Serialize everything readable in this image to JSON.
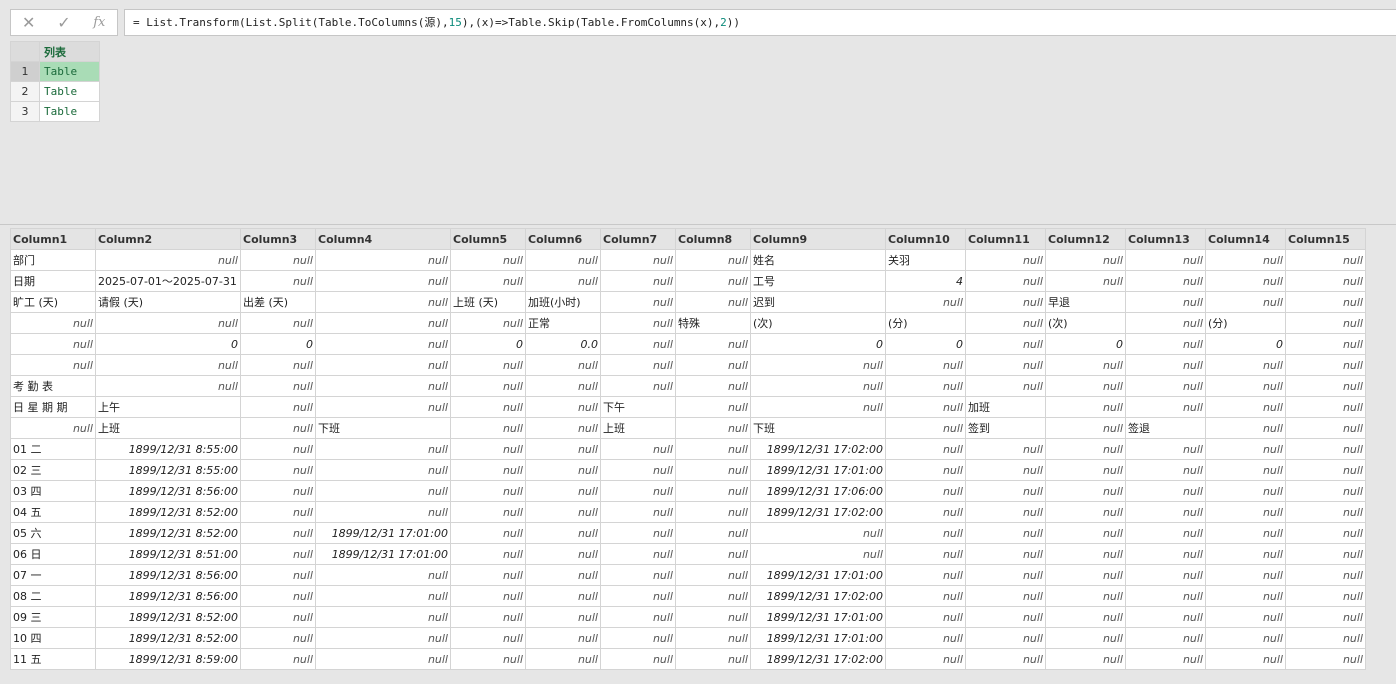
{
  "formula_bar": {
    "cancel_icon": "✕",
    "confirm_icon": "✓",
    "fx_label": "fx",
    "formula": [
      {
        "t": "= List.Transform(List.Split(Table.ToColumns(源),",
        "c": ""
      },
      {
        "t": "15",
        "c": "num"
      },
      {
        "t": "),(x)=>Table.Skip(Table.FromColumns(x),",
        "c": ""
      },
      {
        "t": "2",
        "c": "num"
      },
      {
        "t": "))",
        "c": ""
      }
    ]
  },
  "list_preview": {
    "header": "列表",
    "rows": [
      {
        "num": "1",
        "value": "Table"
      },
      {
        "num": "2",
        "value": "Table"
      },
      {
        "num": "3",
        "value": "Table"
      }
    ]
  },
  "table": {
    "columns": [
      "Column1",
      "Column2",
      "Column3",
      "Column4",
      "Column5",
      "Column6",
      "Column7",
      "Column8",
      "Column9",
      "Column10",
      "Column11",
      "Column12",
      "Column13",
      "Column14",
      "Column15"
    ],
    "rows": [
      [
        "部门",
        "null",
        "null",
        "null",
        "null",
        "null",
        "null",
        "null",
        "姓名",
        "关羽",
        "null",
        "null",
        "null",
        "null",
        "null"
      ],
      [
        "日期",
        "2025-07-01～2025-07-31",
        "null",
        "null",
        "null",
        "null",
        "null",
        "null",
        "工号",
        "4",
        "null",
        "null",
        "null",
        "null",
        "null"
      ],
      [
        "旷工 (天)",
        "请假 (天)",
        "出差 (天)",
        "null",
        "上班 (天)",
        "加班(小时)",
        "null",
        "null",
        "迟到",
        "null",
        "null",
        "早退",
        "null",
        "null",
        "null"
      ],
      [
        "null",
        "null",
        "null",
        "null",
        "null",
        "正常",
        "null",
        "特殊",
        "(次)",
        "(分)",
        "null",
        "(次)",
        "null",
        "(分)",
        "null"
      ],
      [
        "null",
        "0",
        "0",
        "null",
        "0",
        "0.0",
        "null",
        "null",
        "0",
        "0",
        "null",
        "0",
        "null",
        "0",
        "null"
      ],
      [
        "null",
        "null",
        "null",
        "null",
        "null",
        "null",
        "null",
        "null",
        "null",
        "null",
        "null",
        "null",
        "null",
        "null",
        "null"
      ],
      [
        "考 勤 表",
        "null",
        "null",
        "null",
        "null",
        "null",
        "null",
        "null",
        "null",
        "null",
        "null",
        "null",
        "null",
        "null",
        "null"
      ],
      [
        "日 星 期 期",
        "上午",
        "null",
        "null",
        "null",
        "null",
        "下午",
        "null",
        "null",
        "null",
        "加班",
        "null",
        "null",
        "null",
        "null"
      ],
      [
        "null",
        "上班",
        "null",
        "下班",
        "null",
        "null",
        "上班",
        "null",
        "下班",
        "null",
        "签到",
        "null",
        "签退",
        "null",
        "null"
      ],
      [
        "01 二",
        "1899/12/31 8:55:00",
        "null",
        "null",
        "null",
        "null",
        "null",
        "null",
        "1899/12/31 17:02:00",
        "null",
        "null",
        "null",
        "null",
        "null",
        "null"
      ],
      [
        "02 三",
        "1899/12/31 8:55:00",
        "null",
        "null",
        "null",
        "null",
        "null",
        "null",
        "1899/12/31 17:01:00",
        "null",
        "null",
        "null",
        "null",
        "null",
        "null"
      ],
      [
        "03 四",
        "1899/12/31 8:56:00",
        "null",
        "null",
        "null",
        "null",
        "null",
        "null",
        "1899/12/31 17:06:00",
        "null",
        "null",
        "null",
        "null",
        "null",
        "null"
      ],
      [
        "04 五",
        "1899/12/31 8:52:00",
        "null",
        "null",
        "null",
        "null",
        "null",
        "null",
        "1899/12/31 17:02:00",
        "null",
        "null",
        "null",
        "null",
        "null",
        "null"
      ],
      [
        "05 六",
        "1899/12/31 8:52:00",
        "null",
        "1899/12/31 17:01:00",
        "null",
        "null",
        "null",
        "null",
        "null",
        "null",
        "null",
        "null",
        "null",
        "null",
        "null"
      ],
      [
        "06 日",
        "1899/12/31 8:51:00",
        "null",
        "1899/12/31 17:01:00",
        "null",
        "null",
        "null",
        "null",
        "null",
        "null",
        "null",
        "null",
        "null",
        "null",
        "null"
      ],
      [
        "07 一",
        "1899/12/31 8:56:00",
        "null",
        "null",
        "null",
        "null",
        "null",
        "null",
        "1899/12/31 17:01:00",
        "null",
        "null",
        "null",
        "null",
        "null",
        "null"
      ],
      [
        "08 二",
        "1899/12/31 8:56:00",
        "null",
        "null",
        "null",
        "null",
        "null",
        "null",
        "1899/12/31 17:02:00",
        "null",
        "null",
        "null",
        "null",
        "null",
        "null"
      ],
      [
        "09 三",
        "1899/12/31 8:52:00",
        "null",
        "null",
        "null",
        "null",
        "null",
        "null",
        "1899/12/31 17:01:00",
        "null",
        "null",
        "null",
        "null",
        "null",
        "null"
      ],
      [
        "10 四",
        "1899/12/31 8:52:00",
        "null",
        "null",
        "null",
        "null",
        "null",
        "null",
        "1899/12/31 17:01:00",
        "null",
        "null",
        "null",
        "null",
        "null",
        "null"
      ],
      [
        "11 五",
        "1899/12/31 8:59:00",
        "null",
        "null",
        "null",
        "null",
        "null",
        "null",
        "1899/12/31 17:02:00",
        "null",
        "null",
        "null",
        "null",
        "null",
        "null"
      ]
    ]
  }
}
